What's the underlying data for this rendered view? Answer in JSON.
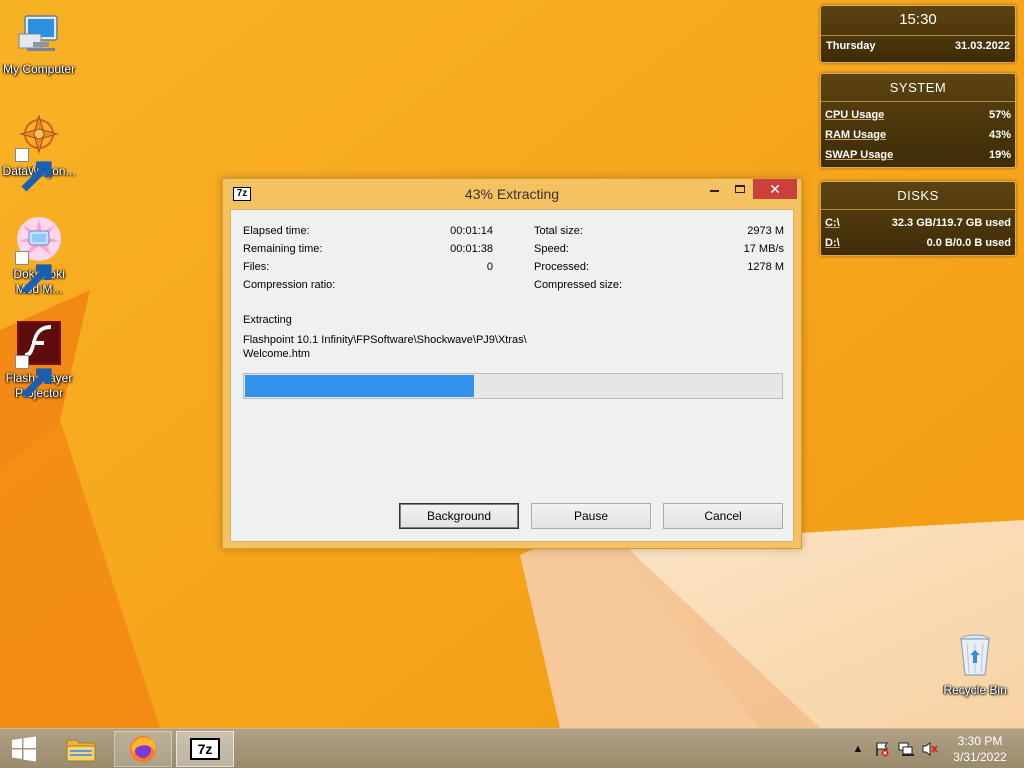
{
  "colors": {
    "accent_progress": "#3393ec",
    "close_button": "#c8423b",
    "window_frame": "#f5c261",
    "gadget_bg": "#4e3a0f",
    "wallpaper": "#f7a81b"
  },
  "desktop": {
    "icons": [
      {
        "label": "My Computer",
        "icon": "computer-icon"
      },
      {
        "label": "DataWagon...",
        "icon": "datawagon-icon"
      },
      {
        "label": "Doki Doki Mod M...",
        "icon": "doki-doki-icon"
      },
      {
        "label": "Flash Player Projector",
        "icon": "flash-player-icon"
      },
      {
        "label": "Recycle Bin",
        "icon": "recycle-bin-icon"
      }
    ]
  },
  "gadgets": {
    "clock": {
      "time": "15:30",
      "day": "Thursday",
      "date": "31.03.2022"
    },
    "system": {
      "title": "SYSTEM",
      "rows": [
        {
          "label": "CPU Usage",
          "value": "57%"
        },
        {
          "label": "RAM Usage",
          "value": "43%"
        },
        {
          "label": "SWAP Usage",
          "value": "19%"
        }
      ]
    },
    "disks": {
      "title": "DISKS",
      "rows": [
        {
          "label": "C:\\",
          "value": "32.3 GB/119.7 GB used"
        },
        {
          "label": "D:\\",
          "value": "0.0 B/0.0 B used"
        }
      ]
    }
  },
  "dialog": {
    "icon_text": "7z",
    "title": "43% Extracting",
    "stats_left": [
      {
        "label": "Elapsed time:",
        "value": "00:01:14"
      },
      {
        "label": "Remaining time:",
        "value": "00:01:38"
      },
      {
        "label": "Files:",
        "value": "0"
      },
      {
        "label": "Compression ratio:",
        "value": ""
      }
    ],
    "stats_right": [
      {
        "label": "Total size:",
        "value": "2973 M"
      },
      {
        "label": "Speed:",
        "value": "17 MB/s"
      },
      {
        "label": "Processed:",
        "value": "1278 M"
      },
      {
        "label": "Compressed size:",
        "value": ""
      }
    ],
    "status_label": "Extracting",
    "path_line1": "Flashpoint 10.1 Infinity\\FPSoftware\\Shockwave\\PJ9\\Xtras\\",
    "path_line2": "Welcome.htm",
    "progress_fraction": 0.43,
    "buttons": {
      "background": "Background",
      "pause": "Pause",
      "cancel": "Cancel"
    },
    "controls": {
      "minimize": "minimize-icon",
      "maximize": "maximize-icon",
      "close": "close-icon"
    }
  },
  "taskbar": {
    "start_icon": "windows-logo-icon",
    "items": [
      "file-explorer-icon",
      "firefox-icon",
      "7zip-icon"
    ],
    "seven_zip_label": "7z",
    "tray": [
      "chevron-up-icon",
      "action-center-flag-icon",
      "network-icon",
      "volume-muted-icon"
    ],
    "time": "3:30 PM",
    "date": "3/31/2022"
  }
}
